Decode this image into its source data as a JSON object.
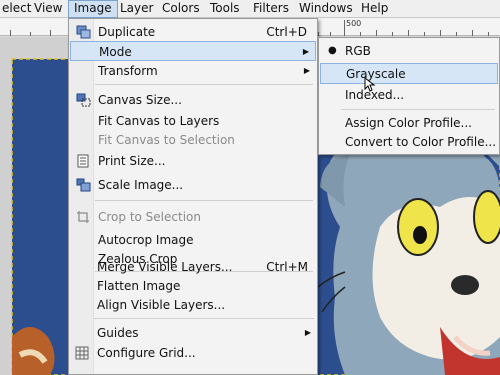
{
  "menubar": {
    "items": [
      {
        "label": "elect"
      },
      {
        "label": "View"
      },
      {
        "label": "Image"
      },
      {
        "label": "Layer"
      },
      {
        "label": "Colors"
      },
      {
        "label": "Tools"
      },
      {
        "label": "Filters"
      },
      {
        "label": "Windows"
      },
      {
        "label": "Help"
      }
    ]
  },
  "ruler": {
    "label": "500"
  },
  "image_menu": {
    "items": [
      {
        "label": "Duplicate",
        "accel": "Ctrl+D",
        "icon": "duplicate-icon"
      },
      {
        "label": "Mode",
        "submenu": true
      },
      {
        "label": "Transform",
        "submenu": true
      },
      {
        "label": "Canvas Size...",
        "icon": "canvas-size-icon"
      },
      {
        "label": "Fit Canvas to Layers"
      },
      {
        "label": "Fit Canvas to Selection",
        "disabled": true
      },
      {
        "label": "Print Size...",
        "icon": "print-size-icon"
      },
      {
        "label": "Scale Image...",
        "icon": "scale-image-icon"
      },
      {
        "label": "Crop to Selection",
        "disabled": true,
        "icon": "crop-icon"
      },
      {
        "label": "Autocrop Image"
      },
      {
        "label": "Zealous Crop"
      },
      {
        "label": "Merge Visible Layers...",
        "accel": "Ctrl+M"
      },
      {
        "label": "Flatten Image"
      },
      {
        "label": "Align Visible Layers..."
      },
      {
        "label": "Guides",
        "submenu": true
      },
      {
        "label": "Configure Grid...",
        "icon": "grid-icon"
      }
    ]
  },
  "mode_submenu": {
    "items": [
      {
        "label": "RGB",
        "selected": true
      },
      {
        "label": "Grayscale",
        "highlighted": true
      },
      {
        "label": "Indexed..."
      },
      {
        "label": "Assign Color Profile..."
      },
      {
        "label": "Convert to Color Profile..."
      }
    ]
  },
  "colors": {
    "accent": "#cfe0f3",
    "image_background": "#2f4f8f",
    "cat_body": "#8ea6b8"
  }
}
